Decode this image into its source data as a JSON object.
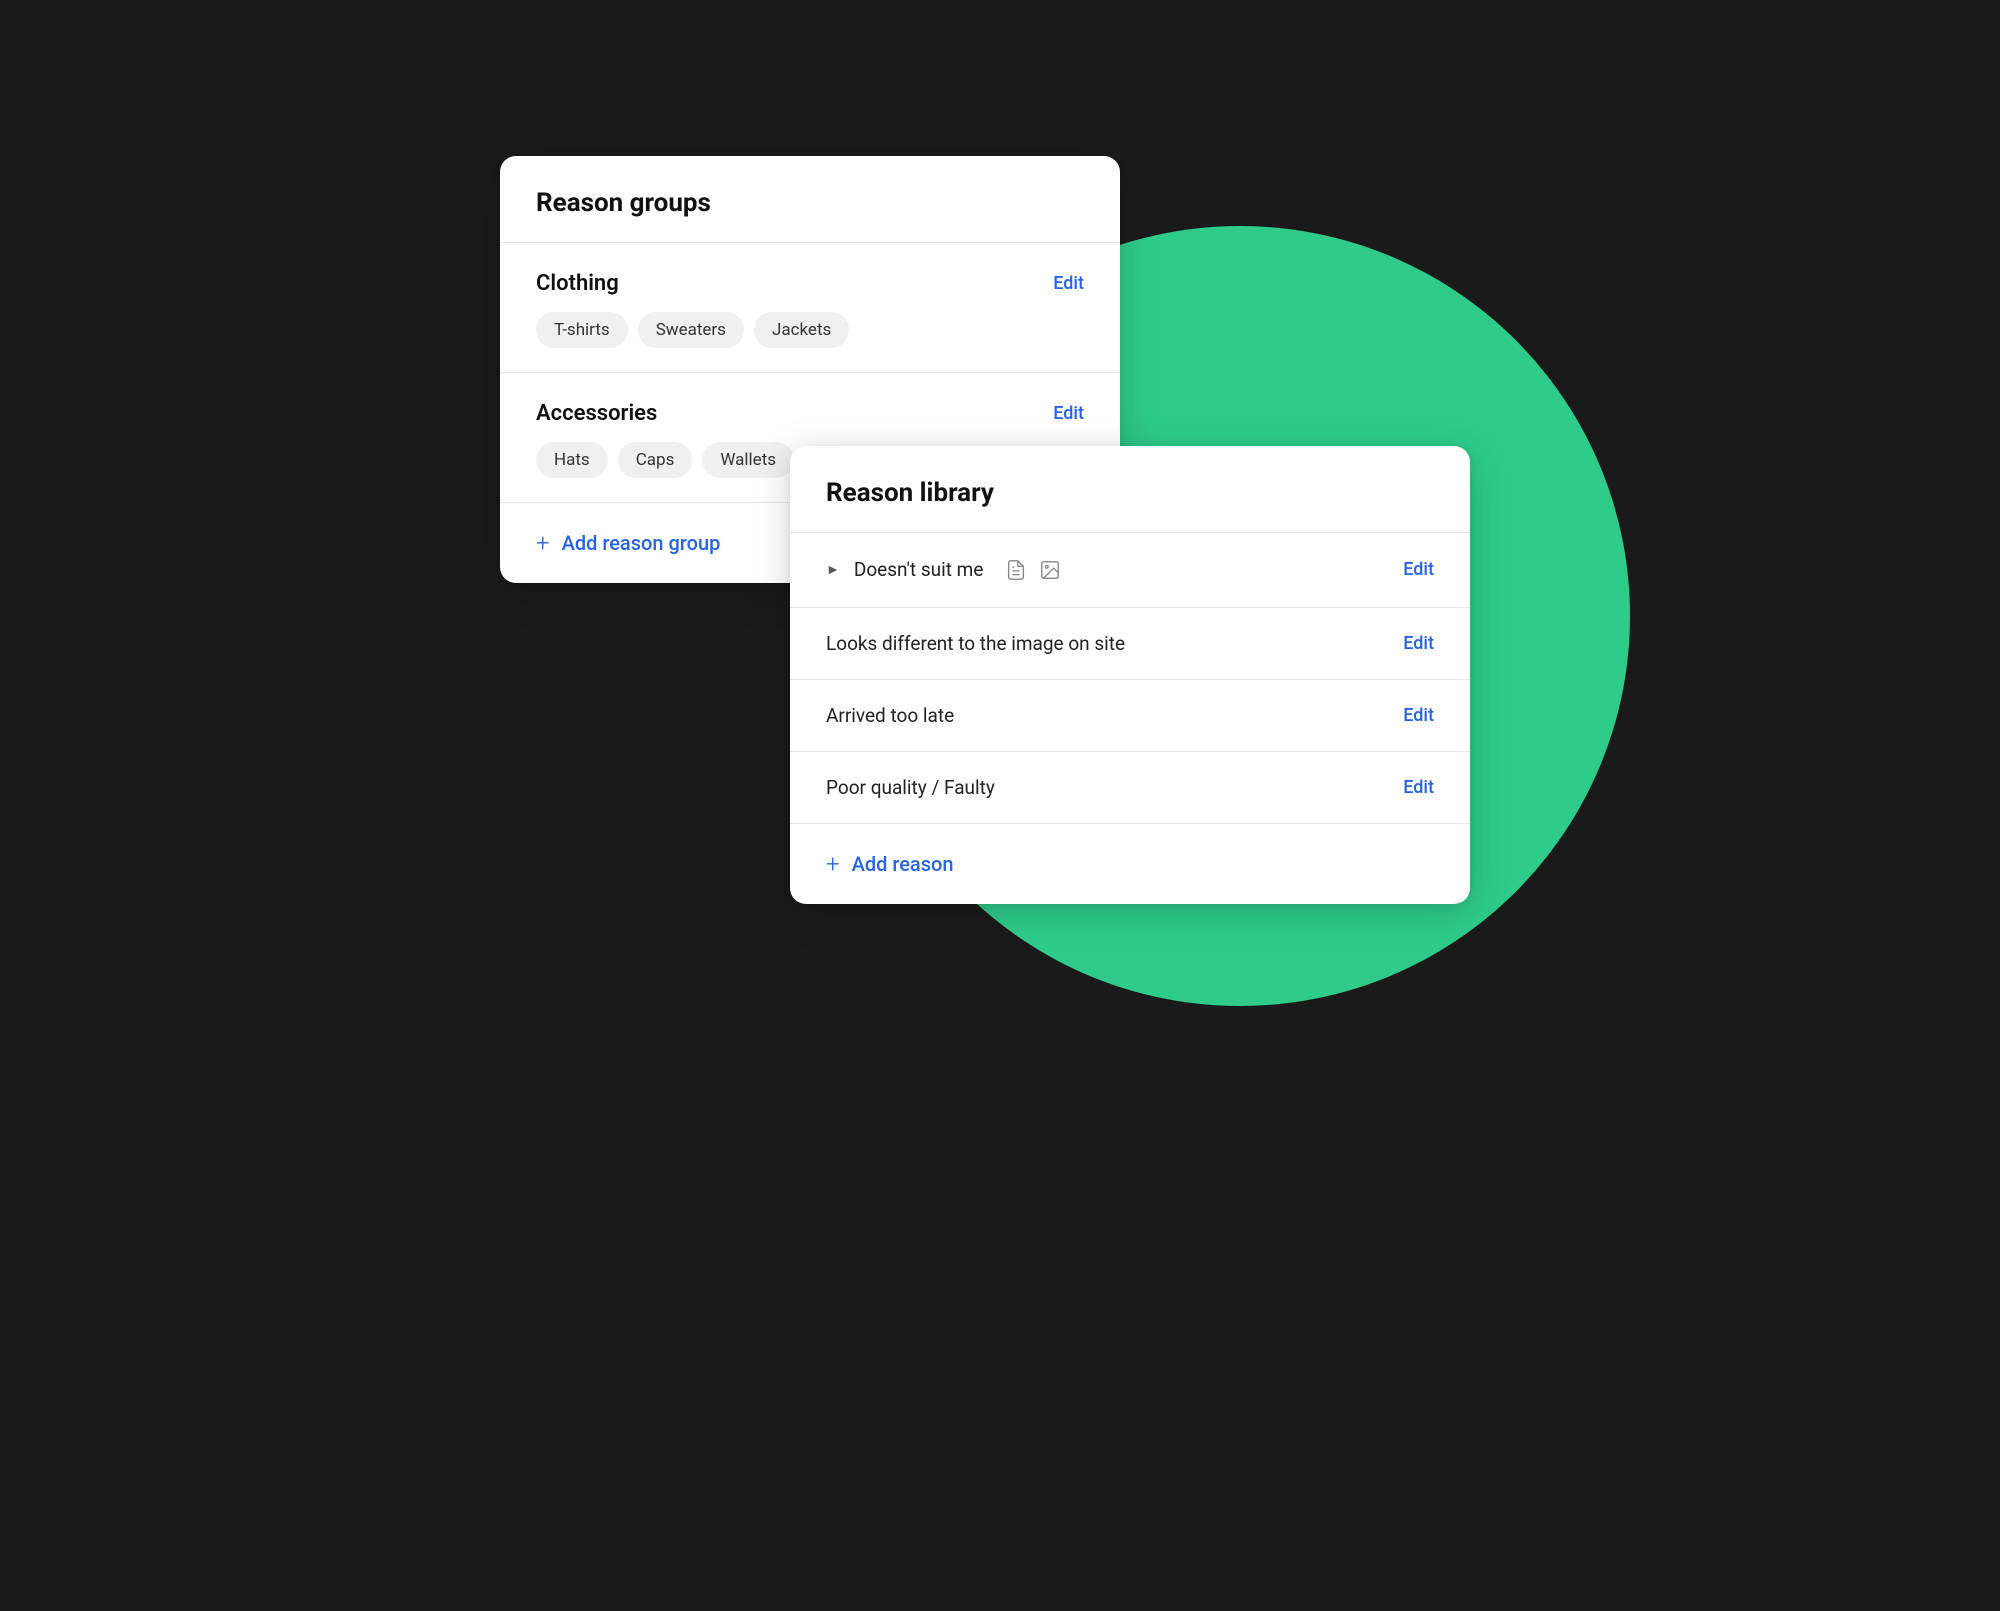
{
  "scene": {
    "background_color": "#1a1a1a",
    "green_circle_color": "#2ecb8a"
  },
  "reason_groups_card": {
    "title": "Reason groups",
    "groups": [
      {
        "name": "Clothing",
        "edit_label": "Edit",
        "tags": [
          "T-shirts",
          "Sweaters",
          "Jackets"
        ]
      },
      {
        "name": "Accessories",
        "edit_label": "Edit",
        "tags": [
          "Hats",
          "Caps",
          "Wallets"
        ]
      }
    ],
    "add_group_label": "Add reason group"
  },
  "reason_library_card": {
    "title": "Reason library",
    "reasons": [
      {
        "name": "Doesn't suit me",
        "has_chevron": true,
        "has_doc_icon": true,
        "has_img_icon": true,
        "edit_label": "Edit"
      },
      {
        "name": "Looks different to the image on site",
        "has_chevron": false,
        "has_doc_icon": false,
        "has_img_icon": false,
        "edit_label": "Edit"
      },
      {
        "name": "Arrived too late",
        "has_chevron": false,
        "has_doc_icon": false,
        "has_img_icon": false,
        "edit_label": "Edit"
      },
      {
        "name": "Poor quality / Faulty",
        "has_chevron": false,
        "has_doc_icon": false,
        "has_img_icon": false,
        "edit_label": "Edit"
      }
    ],
    "add_reason_label": "Add reason"
  },
  "colors": {
    "blue": "#2563eb",
    "green": "#2ecb8a"
  }
}
